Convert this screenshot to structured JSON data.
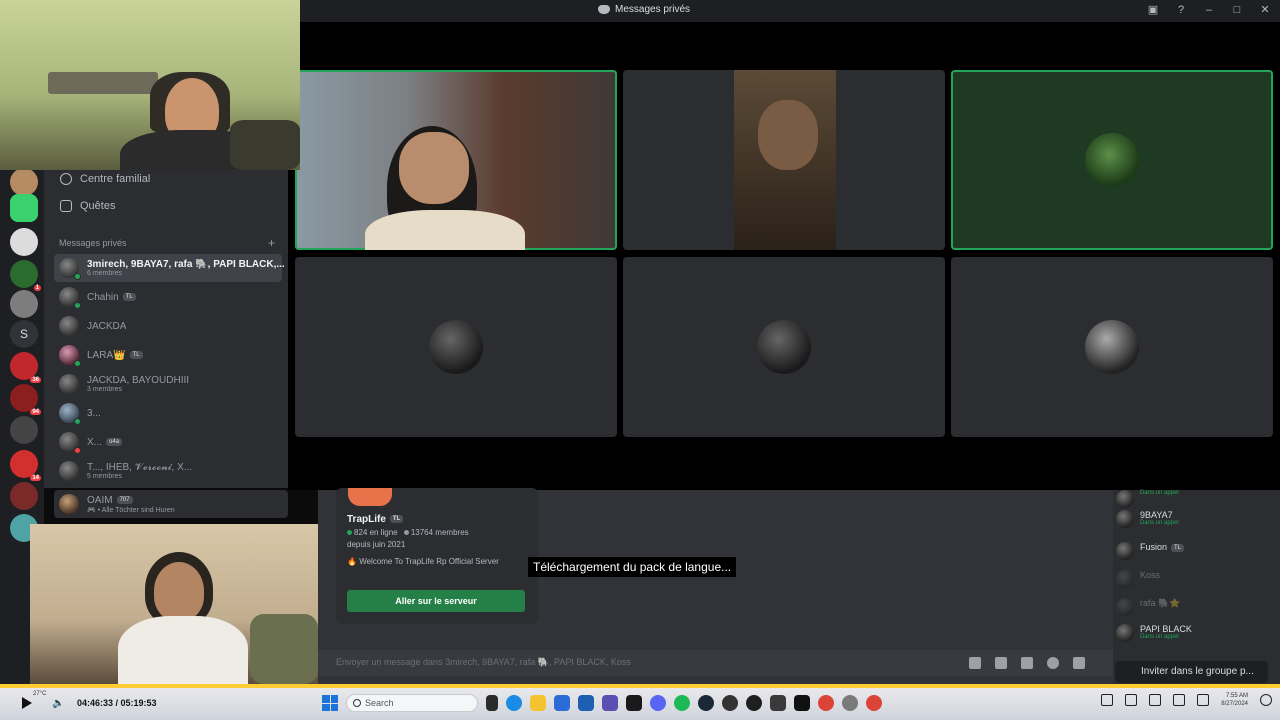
{
  "window": {
    "title": "Messages privés"
  },
  "dm_nav": {
    "family": "Centre familial",
    "quests": "Quêtes",
    "section_header": "Messages privés",
    "add_label": "+"
  },
  "dms": [
    {
      "name": "3mirech, 9BAYA7, rafa 🐘, PAPI BLACK,...",
      "sub": "6 membres",
      "active": true
    },
    {
      "name": "Chahin",
      "tag": "TL"
    },
    {
      "name": "JACKDA"
    },
    {
      "name": "LARA👑",
      "tag": "TL"
    },
    {
      "name": "JACKDA, BAYOUDHIII",
      "sub": "3 membres"
    },
    {
      "name": "3..."
    },
    {
      "name": "X...",
      "tag": "o4a"
    },
    {
      "name": "T..., IHEB, 𝓥𝓮𝓻𝓸𝓸𝓷𝓲, X...",
      "sub": "5 membres"
    },
    {
      "name": "OAIM",
      "tag": "707",
      "sub": "🎮 • Alle Töchter sind Huren"
    }
  ],
  "server_badges": [
    "1",
    "36",
    "94",
    "14"
  ],
  "invite_card": {
    "server_name": "TrapLife",
    "server_tag": "TL",
    "online": "824 en ligne",
    "members": "13764 membres",
    "since": "depuis juin 2021",
    "description": "Welcome To TrapLife Rp Official Server",
    "join_button": "Aller sur le serveur"
  },
  "toast": "Téléchargement du pack de langue...",
  "message_input": {
    "placeholder": "Envoyer un message dans 3mirech, 9BAYA7, rafa 🐘, PAPI BLACK, Koss"
  },
  "members": [
    {
      "name": "",
      "status": "Dans un appel"
    },
    {
      "name": "9BAYA7",
      "status": "Dans un appel"
    },
    {
      "name": "Fusion",
      "tag": "TL"
    },
    {
      "name": "Koss",
      "dim": true
    },
    {
      "name": "rafa 🐘⭐",
      "dim": true
    },
    {
      "name": "PAPI BLACK",
      "status": "Dans un appel"
    }
  ],
  "invite_group_button": "Inviter dans le groupe p...",
  "player": {
    "temperature": "27°C",
    "time": "04:46:33 / 05:19:53",
    "search": "Search",
    "clock_time": "7:55 AM",
    "clock_date": "8/27/2024"
  },
  "colors": {
    "accent_green": "#23a559",
    "join_green": "#248046",
    "progress": "#ffcc33"
  }
}
